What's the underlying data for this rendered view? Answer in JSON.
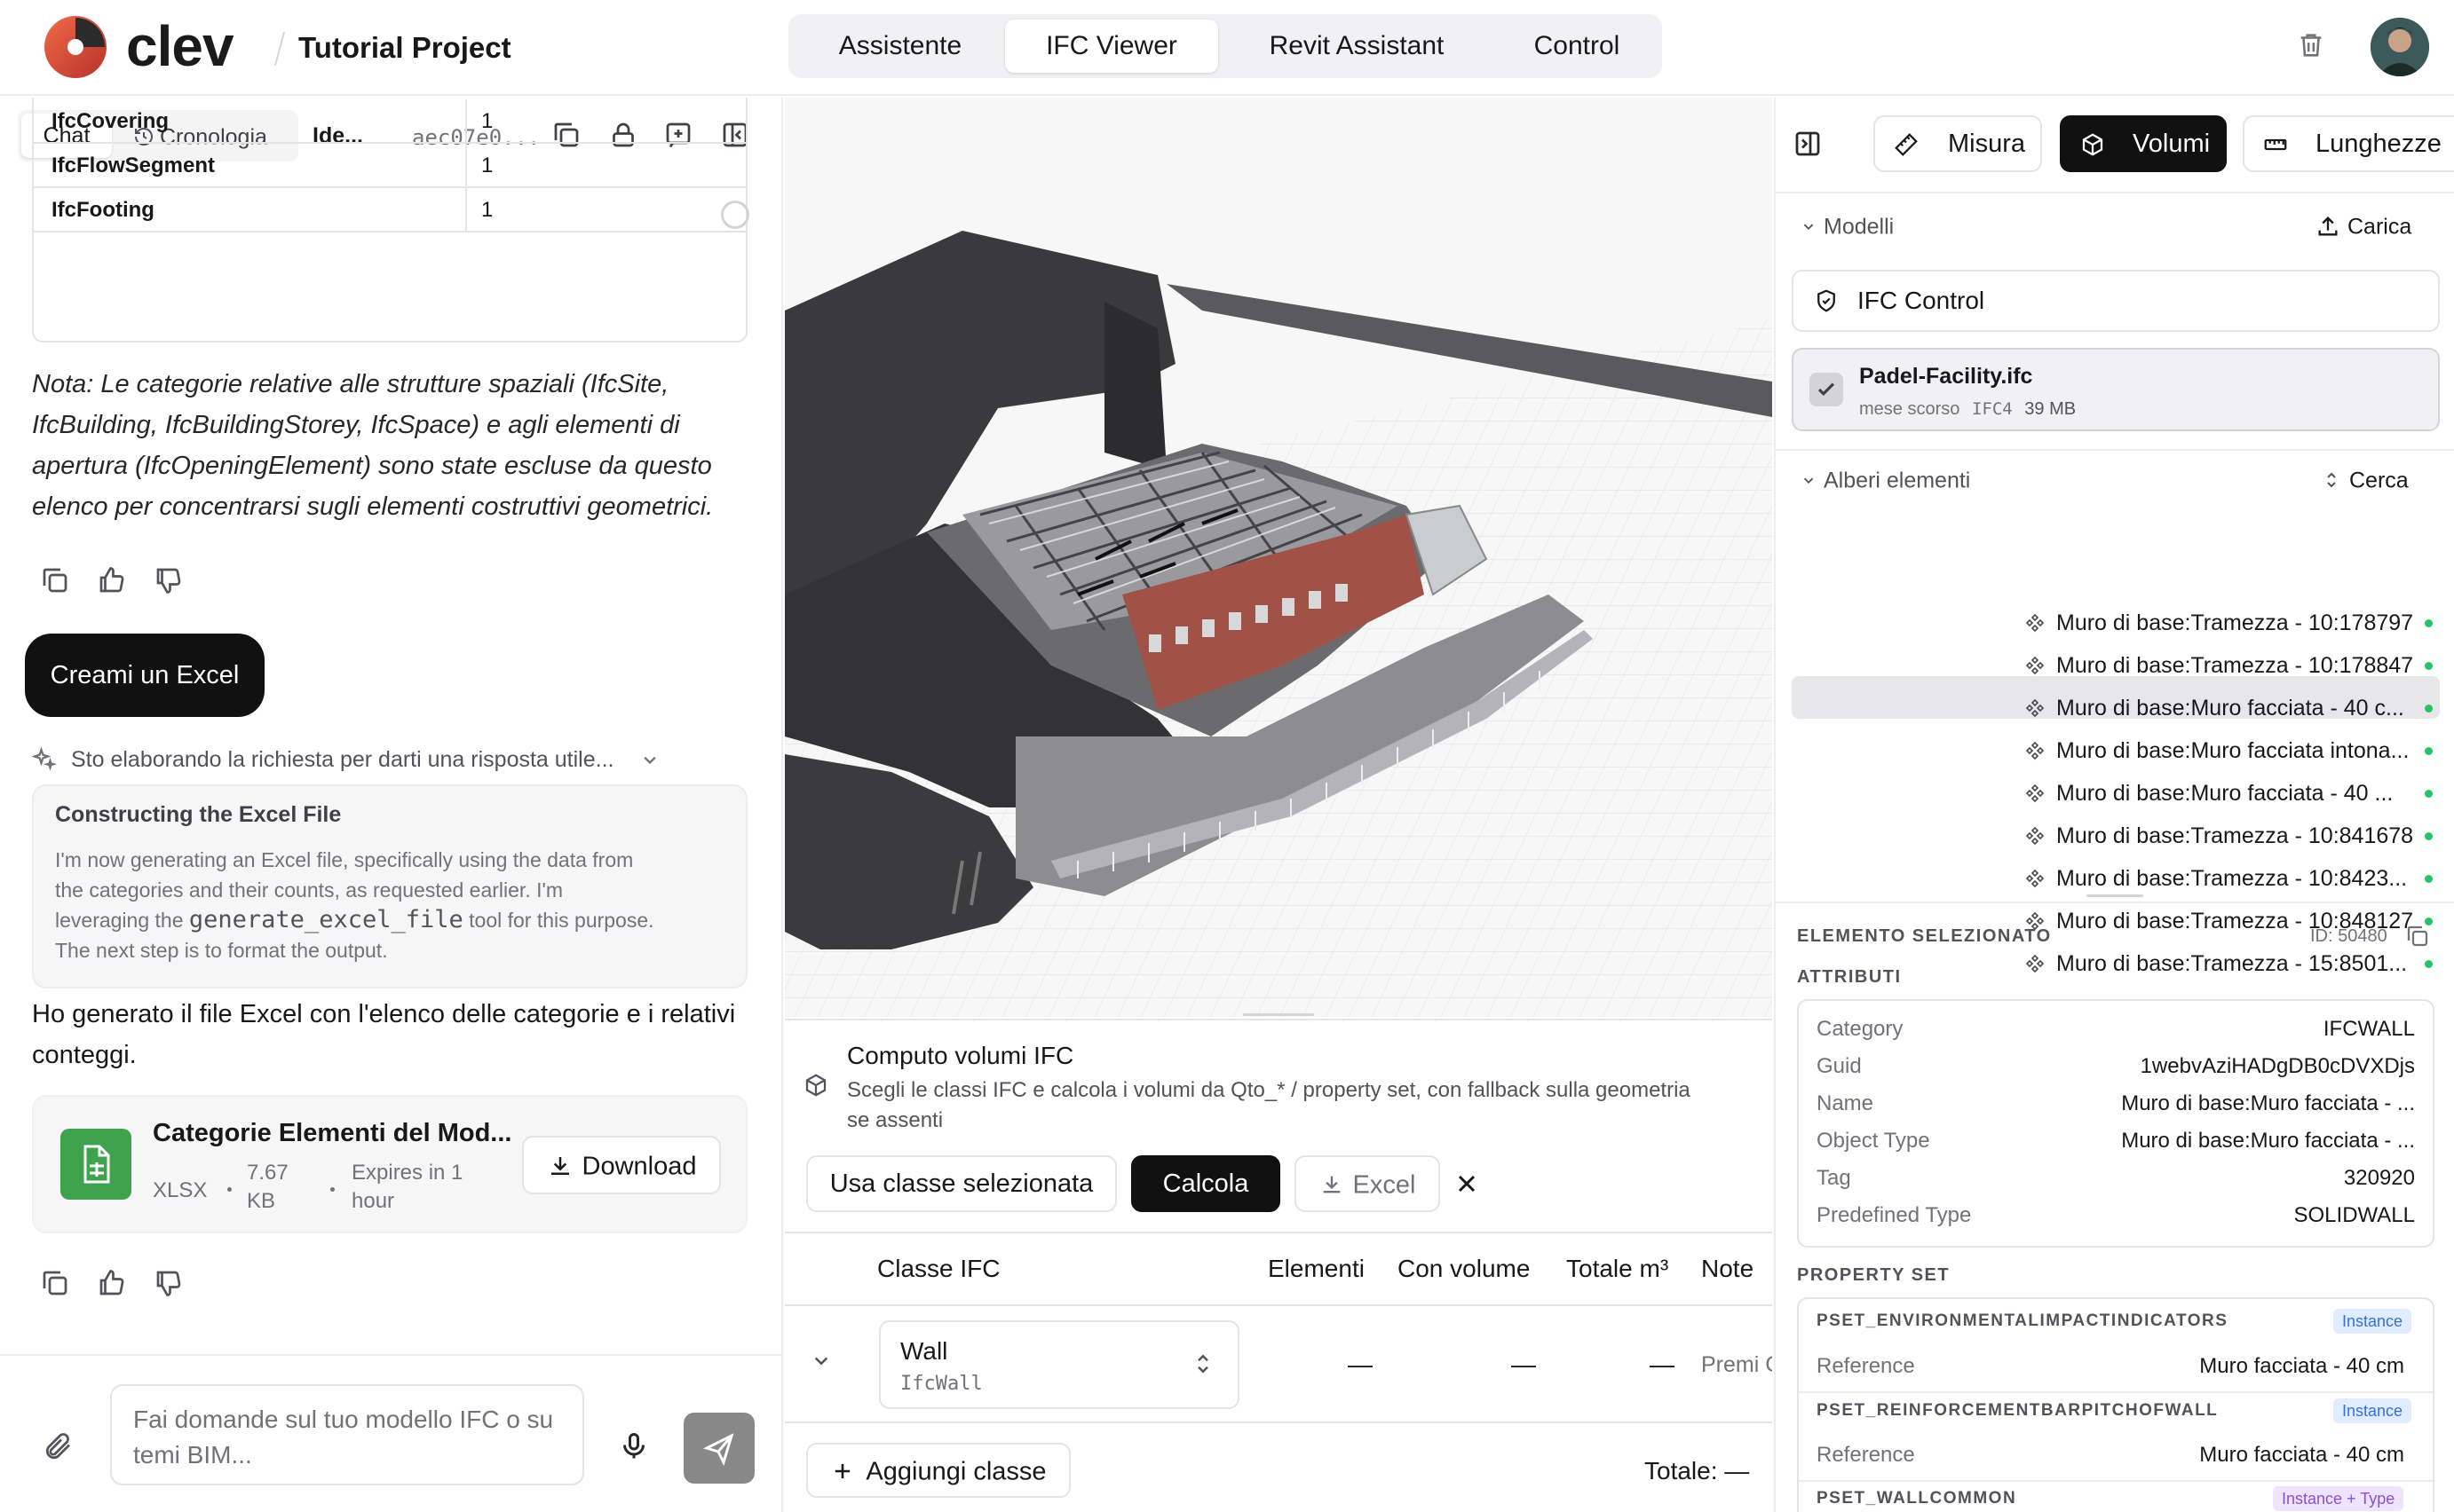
{
  "header": {
    "logo_text": "clev",
    "project_title": "Tutorial Project",
    "nav_tabs": [
      "Assistente",
      "IFC Viewer",
      "Revit Assistant",
      "Control"
    ],
    "active_tab": "IFC Viewer",
    "colors": {
      "accent": "#e5533d",
      "dark": "#111111"
    }
  },
  "chat": {
    "tabs": {
      "chat": "Chat",
      "history": "Cronologia",
      "ide": "Ide..."
    },
    "session_id": "aec07e0...",
    "table_rows": [
      {
        "category": "IfcCovering",
        "count": "1"
      },
      {
        "category": "IfcFlowSegment",
        "count": "1"
      },
      {
        "category": "IfcFooting",
        "count": "1"
      }
    ],
    "note": "Nota: Le categorie relative alle strutture spaziali (IfcSite, IfcBuilding, IfcBuildingStorey, IfcSpace) e agli elementi di apertura (IfcOpeningElement) sono state escluse da questo elenco per concentrarsi sugli elementi costruttivi geometrici.",
    "note_lines": [
      "Nota: Le categorie relative alle strutture spaziali (IfcSite,",
      "IfcBuilding, IfcBuildingStorey, IfcSpace) e agli elementi di",
      "apertura (IfcOpeningElement) sono state escluse da questo",
      "elenco per concentrarsi sugli elementi costruttivi geometrici."
    ],
    "user_message": "Creami un Excel",
    "thinking_status": "Sto elaborando la richiesta per darti una risposta utile...",
    "thinking_title": "Constructing the Excel File",
    "thinking_lines": [
      "I'm now generating an Excel file, specifically using the data from",
      "the categories and their counts, as requested earlier. I'm",
      "leveraging the",
      "generate_excel_file",
      "tool for this purpose.",
      "The next step is to format the output."
    ],
    "reply_lines": [
      "Ho generato il file Excel con l'elenco delle categorie e i relativi",
      "conteggi."
    ],
    "file": {
      "name": "Categorie Elementi del Mod...",
      "type": "XLSX",
      "size_line1": "7.67",
      "size_line2": "KB",
      "expires_line1": "Expires in 1",
      "expires_line2": "hour",
      "download_label": "Download"
    },
    "input_placeholder_line1": "Fai domande sul tuo modello IFC o su",
    "input_placeholder_line2": "temi BIM..."
  },
  "volumes": {
    "title": "Computo volumi IFC",
    "description_line1": "Scegli le classi IFC e calcola i volumi da Qto_* / property set, con fallback sulla geometria",
    "description_line2": "se assenti",
    "use_selected_label": "Usa classe selezionata",
    "calculate_label": "Calcola",
    "excel_label": "Excel",
    "columns": [
      "Classe IFC",
      "Elementi",
      "Con volume",
      "Totale m³",
      "Note"
    ],
    "row": {
      "class_name": "Wall",
      "class_code": "IfcWall",
      "elements": "—",
      "with_volume": "—",
      "total": "—",
      "note": "Premi C"
    },
    "add_class_label": "Aggiungi classe",
    "total_label": "Totale: —"
  },
  "inspector": {
    "tools": {
      "measure": "Misura",
      "volumes": "Volumi",
      "lengths": "Lunghezze"
    },
    "models_label": "Modelli",
    "upload_label": "Carica",
    "ifc_control_label": "IFC Control",
    "model_file": {
      "name": "Padel-Facility.ifc",
      "time": "mese scorso",
      "schema": "IFC4",
      "size": "39 MB"
    },
    "tree_label": "Alberi elementi",
    "search_label": "Cerca",
    "tree_items": [
      "Muro di base:Tramezza - 10:178797",
      "Muro di base:Tramezza - 10:178847",
      "Muro di base:Muro facciata - 40 c...",
      "Muro di base:Muro facciata intona...",
      "Muro di base:Muro facciata - 40 ...",
      "Muro di base:Tramezza - 10:841678",
      "Muro di base:Tramezza - 10:8423...",
      "Muro di base:Tramezza - 10:848127",
      "Muro di base:Tramezza - 15:8501..."
    ],
    "selected_tree_index": 4,
    "selected_header": "ELEMENTO SELEZIONATO",
    "selected_id": "ID: 50480",
    "attributes_header": "ATTRIBUTI",
    "attributes": [
      {
        "label": "Category",
        "value": "IFCWALL"
      },
      {
        "label": "Guid",
        "value": "1webvAziHADgDB0cDVXDjs"
      },
      {
        "label": "Name",
        "value": "Muro di base:Muro facciata - ..."
      },
      {
        "label": "Object Type",
        "value": "Muro di base:Muro facciata - ..."
      },
      {
        "label": "Tag",
        "value": "320920"
      },
      {
        "label": "Predefined Type",
        "value": "SOLIDWALL"
      }
    ],
    "property_set_header": "PROPERTY SET",
    "property_sets": [
      {
        "name": "PSET_ENVIRONMENTALIMPACTINDICATORS",
        "badge": "Instance",
        "ref_label": "Reference",
        "ref_value": "Muro facciata - 40 cm"
      },
      {
        "name": "PSET_REINFORCEMENTBARPITCHOFWALL",
        "badge": "Instance",
        "ref_label": "Reference",
        "ref_value": "Muro facciata - 40 cm"
      },
      {
        "name": "PSET_WALLCOMMON",
        "badge": "Instance + Type"
      }
    ]
  }
}
